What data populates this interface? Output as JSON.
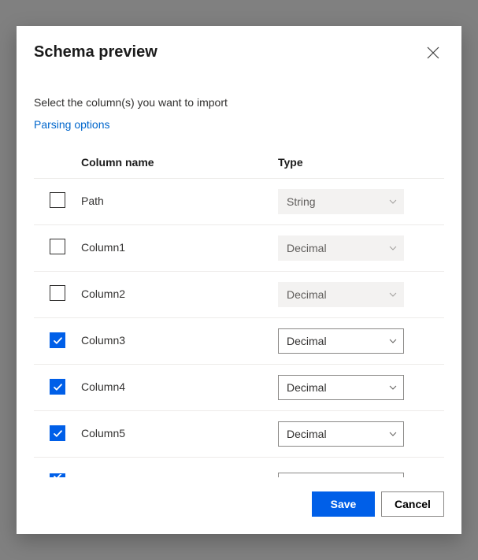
{
  "dialog": {
    "title": "Schema preview",
    "instruction": "Select the column(s) you want to import",
    "parsing_link": "Parsing options"
  },
  "table": {
    "headers": {
      "name": "Column name",
      "type": "Type"
    },
    "rows": [
      {
        "checked": false,
        "name": "Path",
        "type": "String"
      },
      {
        "checked": false,
        "name": "Column1",
        "type": "Decimal"
      },
      {
        "checked": false,
        "name": "Column2",
        "type": "Decimal"
      },
      {
        "checked": true,
        "name": "Column3",
        "type": "Decimal"
      },
      {
        "checked": true,
        "name": "Column4",
        "type": "Decimal"
      },
      {
        "checked": true,
        "name": "Column5",
        "type": "Decimal"
      }
    ],
    "partial_row": {
      "checked": true
    }
  },
  "footer": {
    "save": "Save",
    "cancel": "Cancel"
  }
}
